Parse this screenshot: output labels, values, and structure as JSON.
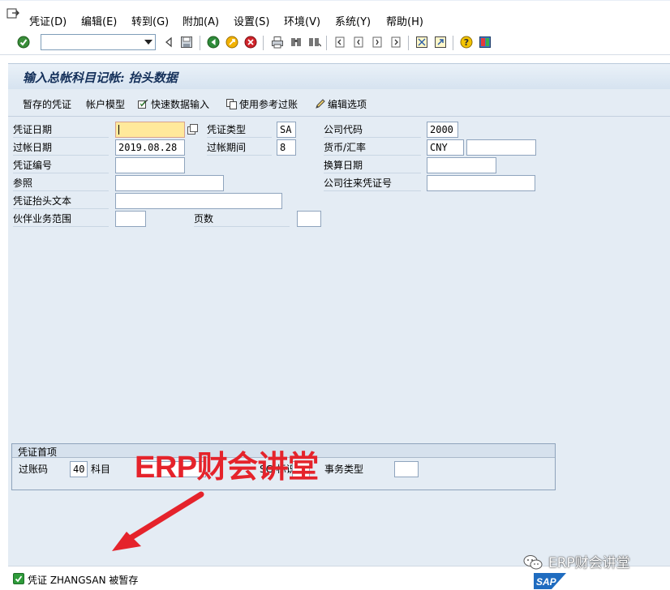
{
  "menubar": {
    "items": [
      "凭证(D)",
      "编辑(E)",
      "转到(G)",
      "附加(A)",
      "设置(S)",
      "环境(V)",
      "系统(Y)",
      "帮助(H)"
    ]
  },
  "toolbar": {
    "command_field_value": "",
    "icons": [
      "enter-icon",
      "back-icon",
      "save-icon",
      "green-back-icon",
      "exit-icon",
      "cancel-icon",
      "print-icon",
      "find-icon",
      "find-next-icon",
      "first-page-icon",
      "previous-page-icon",
      "next-page-icon",
      "last-page-icon",
      "create-session-icon",
      "shortcut-icon",
      "help-icon",
      "customize-layout-icon"
    ]
  },
  "title": "输入总帐科目记帐: 抬头数据",
  "app_toolbar": {
    "parked_doc": "暂存的凭证",
    "account_model": "帐户模型",
    "fast_entry": "快速数据输入",
    "post_with_reference": "使用参考过账",
    "editing_options": "编辑选项"
  },
  "form": {
    "doc_date": {
      "label": "凭证日期",
      "value": ""
    },
    "doc_type": {
      "label": "凭证类型",
      "value": "SA"
    },
    "company_code": {
      "label": "公司代码",
      "value": "2000"
    },
    "posting_date": {
      "label": "过帐日期",
      "value": "2019.08.28"
    },
    "period": {
      "label": "过帐期间",
      "value": "8"
    },
    "currency": {
      "label": "货币/汇率",
      "value": "CNY",
      "rate": ""
    },
    "doc_number": {
      "label": "凭证编号",
      "value": ""
    },
    "translation_date": {
      "label": "换算日期",
      "value": ""
    },
    "reference": {
      "label": "参照",
      "value": ""
    },
    "intercompany": {
      "label": "公司往来凭证号",
      "value": ""
    },
    "header_text": {
      "label": "凭证抬头文本",
      "value": ""
    },
    "partner_ba": {
      "label": "伙伴业务范围",
      "value": ""
    },
    "pages": {
      "label": "页数",
      "value": ""
    }
  },
  "first_item": {
    "title": "凭证首项",
    "posting_key_label": "过账码",
    "posting_key_value": "40",
    "account_label": "科目",
    "sgl_label": "SG 标识",
    "trans_type_label": "事务类型"
  },
  "status": {
    "message": "凭证 ZHANGSAN 被暂存",
    "sap_logo": "SAP"
  },
  "watermark": {
    "big": "ERP财会讲堂",
    "small": "ERP财会讲堂"
  },
  "colors": {
    "accent_red": "#e5232b",
    "form_bg": "#e4ecf4",
    "active_field": "#ffe99b",
    "status_green": "#2e9b3a"
  }
}
